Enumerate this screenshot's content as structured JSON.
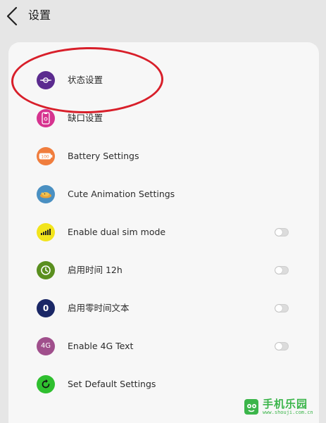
{
  "header": {
    "title": "设置"
  },
  "items": [
    {
      "label": "状态设置",
      "icon": "status-bar-icon",
      "color": "#5b2b8f",
      "has_toggle": false
    },
    {
      "label": "缺口设置",
      "icon": "notch-icon",
      "color": "#d6338f",
      "has_toggle": false
    },
    {
      "label": "Battery Settings",
      "icon": "battery-icon",
      "color": "#f07d3d",
      "has_toggle": false
    },
    {
      "label": "Cute Animation Settings",
      "icon": "cute-animal-icon",
      "color": "#4a90c2",
      "has_toggle": false
    },
    {
      "label": "Enable dual sim mode",
      "icon": "dual-sim-signal-icon",
      "color": "#f2e41c",
      "has_toggle": true,
      "enabled": false
    },
    {
      "label": "启用时间 12h",
      "icon": "clock-icon",
      "color": "#5a8f1f",
      "has_toggle": true,
      "enabled": false
    },
    {
      "label": "启用零时间文本",
      "icon_text": "0",
      "icon": "zero-icon",
      "color": "#1a2766",
      "has_toggle": true,
      "enabled": false
    },
    {
      "label": "Enable 4G Text",
      "icon_text": "4G",
      "icon": "4g-icon",
      "color": "#a04f8c",
      "has_toggle": true,
      "enabled": false
    },
    {
      "label": "Set Default Settings",
      "icon": "reset-icon",
      "color": "#2fbf2f",
      "has_toggle": false
    }
  ],
  "watermark": {
    "text": "手机乐园",
    "url": "www.shouji.com.cn"
  },
  "colors": {
    "background": "#e6e6e6",
    "card": "#f7f7f7",
    "highlight": "#d81f2a",
    "watermark": "#3bb54a"
  }
}
